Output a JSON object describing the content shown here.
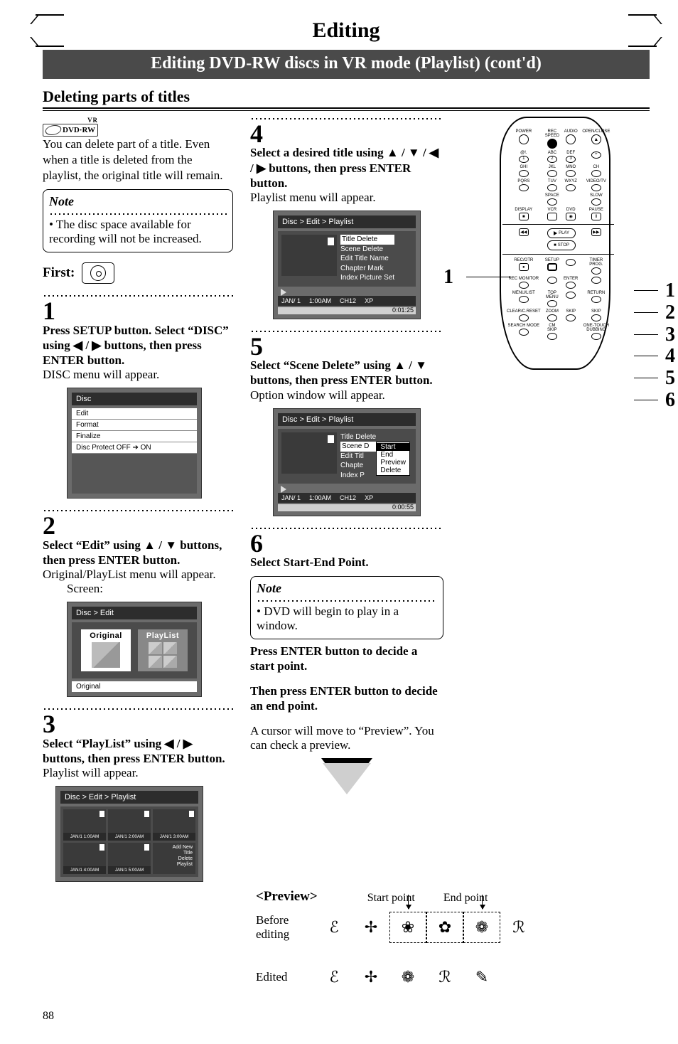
{
  "header": {
    "page_title": "Editing",
    "banner": "Editing DVD-RW discs in VR mode (Playlist) (cont'd)",
    "section": "Deleting parts of titles"
  },
  "dvd_logo": {
    "vr": "VR",
    "text": "DVD·RW"
  },
  "intro": "You can delete part of a title. Even when a title is deleted from the playlist, the original title will remain.",
  "note1": {
    "label": "Note",
    "bullet": "• The disc space available for recording will not be increased."
  },
  "first_label": "First:",
  "steps": {
    "s1": {
      "num": "1",
      "instr": "Press SETUP button. Select “DISC” using ◀ / ▶ buttons, then press ENTER button.",
      "result": "DISC menu will appear."
    },
    "s2": {
      "num": "2",
      "instr": "Select “Edit” using ▲ / ▼ buttons, then press ENTER button.",
      "result": "Original/PlayList menu will appear.",
      "screen_label": "Screen:"
    },
    "s3": {
      "num": "3",
      "instr": "Select “PlayList” using ◀ / ▶ buttons, then press ENTER button.",
      "result": "Playlist will appear."
    },
    "s4": {
      "num": "4",
      "instr": "Select a desired title using ▲ / ▼ / ◀ / ▶ buttons, then press ENTER button.",
      "result": "Playlist menu will appear."
    },
    "s5": {
      "num": "5",
      "instr": "Select “Scene Delete” using ▲ / ▼ buttons, then press ENTER button.",
      "result": "Option window will appear."
    },
    "s6": {
      "num": "6",
      "instr": "Select Start-End Point.",
      "note_label": "Note",
      "note_text": "• DVD will begin to play in a window.",
      "p1": "Press ENTER button to decide a start point.",
      "p2": "Then press ENTER button to decide an end point.",
      "p3": "A cursor will move to “Preview”. You can check a preview."
    }
  },
  "osd": {
    "disc_menu": {
      "hdr": "Disc",
      "items": [
        "Edit",
        "Format",
        "Finalize",
        "Disc Protect OFF ➔ ON"
      ]
    },
    "edit_menu": {
      "hdr": "Disc > Edit",
      "opt_original": "Original",
      "opt_playlist": "PlayList",
      "footer": "Original"
    },
    "playlist_grid": {
      "hdr": "Disc > Edit > Playlist",
      "cells": [
        "JAN/1  1:00AM",
        "JAN/1  2:00AM",
        "JAN/1  3:00AM",
        "JAN/1  4:00AM",
        "JAN/1  5:00AM"
      ],
      "add": [
        "Add New",
        "Title",
        "Delete",
        "Playlist"
      ]
    },
    "playlist_menu": {
      "hdr": "Disc > Edit > Playlist",
      "items": [
        "Title Delete",
        "Scene Delete",
        "Edit Title Name",
        "Chapter Mark",
        "Index Picture Set"
      ],
      "footer_date": "JAN/ 1",
      "footer_time": "1:00AM",
      "footer_ch": "CH12",
      "footer_q": "XP",
      "progress": "0:01:25"
    },
    "scene_menu": {
      "hdr": "Disc > Edit > Playlist",
      "items": [
        "Title Delete",
        "Scene D",
        "Edit Titl",
        "Chapte",
        "Index P"
      ],
      "sub": [
        "Start",
        "End",
        "Preview",
        "Delete"
      ],
      "footer_date": "JAN/ 1",
      "footer_time": "1:00AM",
      "footer_ch": "CH12",
      "footer_q": "XP",
      "progress": "0:00:55"
    }
  },
  "remote": {
    "rows": [
      [
        "POWER",
        "REC SPEED",
        "AUDIO",
        "OPEN/CLOSE"
      ],
      [
        "@!.",
        "ABC",
        "DEF",
        ""
      ],
      [
        "1",
        "2",
        "3",
        "+"
      ],
      [
        "GHI",
        "JKL",
        "MNO",
        "CH"
      ],
      [
        "4",
        "5",
        "6",
        "▼"
      ],
      [
        "PQRS",
        "TUV",
        "WXYZ",
        "VIDEO/TV"
      ],
      [
        "7",
        "8",
        "9",
        ""
      ],
      [
        "",
        "SPACE",
        "",
        "SLOW"
      ],
      [
        "",
        "0",
        "",
        "▶"
      ],
      [
        "DISPLAY",
        "VCR",
        "DVD",
        "PAUSE"
      ],
      [
        "",
        "",
        "",
        "II"
      ]
    ],
    "transport": {
      "rew": "◀◀",
      "play": "PLAY",
      "ff": "▶▶",
      "stop": "STOP"
    },
    "lower": [
      [
        "REC/OTR",
        "SETUP",
        "",
        "TIMER PROG."
      ],
      [
        "REC MONITOR",
        "",
        "ENTER",
        ""
      ],
      [
        "MENU/LIST",
        "TOP MENU",
        "",
        "RETURN"
      ],
      [
        "CLEAR/C.RESET",
        "ZOOM",
        "SKIP",
        "SKIP"
      ],
      [
        "SEARCH MODE",
        "CM SKIP",
        "",
        "ONE-TOUCH DUBBING"
      ]
    ],
    "callout_left": "1",
    "callout_right": [
      "1",
      "2",
      "3",
      "4",
      "5",
      "6"
    ]
  },
  "preview": {
    "title": "<Preview>",
    "start": "Start point",
    "end": "End point",
    "before": "Before editing",
    "edited": "Edited"
  },
  "page_number": "88"
}
